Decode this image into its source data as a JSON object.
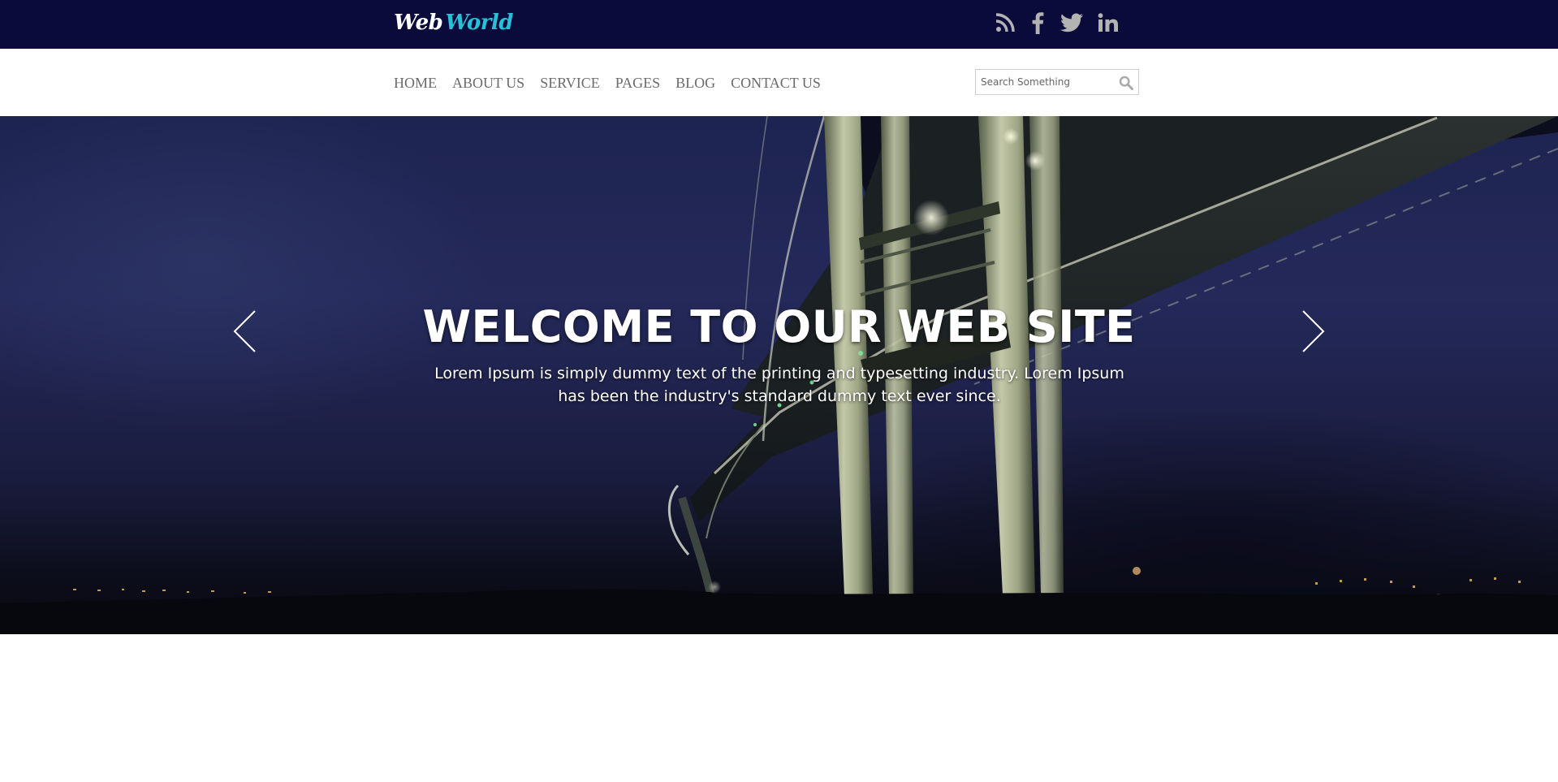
{
  "brand": {
    "logo_part1": "Web",
    "logo_part2": "World",
    "colors": {
      "topbar": "#0b0b3b",
      "logo_accent": "#27c0d6",
      "nav_text": "#6b6b6b",
      "social_icon": "#b3b3b3"
    }
  },
  "social": [
    {
      "name": "rss-icon"
    },
    {
      "name": "facebook-icon"
    },
    {
      "name": "twitter-icon"
    },
    {
      "name": "linkedin-icon"
    }
  ],
  "nav": {
    "items": [
      {
        "label": "HOME"
      },
      {
        "label": "ABOUT US"
      },
      {
        "label": "SERVICE"
      },
      {
        "label": "PAGES"
      },
      {
        "label": "BLOG"
      },
      {
        "label": "CONTACT US"
      }
    ]
  },
  "search": {
    "placeholder": "Search Something",
    "icon": "search-icon"
  },
  "hero": {
    "title": "WELCOME TO OUR WEB SITE",
    "text": "Lorem Ipsum is simply dummy text of the printing and typesetting industry. Lorem Ipsum has been the industry's standard dummy text ever since.",
    "prev_icon": "chevron-left-icon",
    "next_icon": "chevron-right-icon"
  }
}
